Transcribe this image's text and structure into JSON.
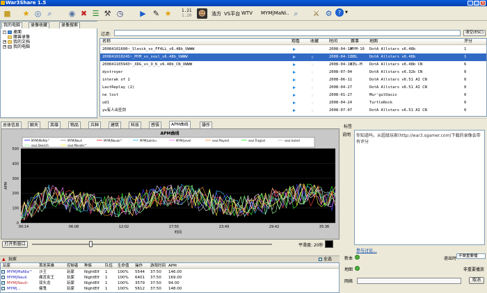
{
  "window": {
    "title": "War3Share 1.5",
    "accent": "#0a5bd8"
  },
  "toolbar": {
    "version_a": "1.21",
    "version_b": "1.20",
    "filter_1": "浩方",
    "filter_2": "VS平台",
    "filter_3": "WTV",
    "player_filter": "MYM|MaNi..",
    "icons": [
      "folder-icon",
      "star-icon",
      "search-icon",
      "settings-icon",
      "stack-icon",
      "clock-icon",
      "play-icon",
      "edit-icon",
      "star-icon",
      "portrait-icon",
      "gear-icon",
      "help-icon"
    ]
  },
  "left": {
    "tabs": [
      "我的电脑",
      "录像收藏",
      "录像搜索"
    ],
    "tree": [
      "桌面",
      "魔兽录像",
      "我的文档",
      "我的电脑"
    ]
  },
  "filter": {
    "label": "过滤:",
    "clear_label": "清空(ESC)"
  },
  "replays": {
    "columns": [
      "名称",
      "观看",
      "收藏",
      "时间",
      "赛事",
      "地图",
      "评分"
    ],
    "rows": [
      {
        "name": "20084101600~_Slevik_vs_FF4LL_v6.48b_UWWW",
        "time": "2008-04-10",
        "event": "MYM-10",
        "map": "DotA Allstars v6.48b",
        "rating": "1",
        "selected": false
      },
      {
        "name": "20084101024S~_MYM_vs_soul_v6.48b_UWWW",
        "time": "2008-04-11",
        "event": "OBL",
        "map": "DotA Allstars v6.48b",
        "rating": "1",
        "selected": true
      },
      {
        "name": "200841105943~_XDG_vs_O_K_v6.48b_CN_UWWW",
        "time": "2008-04-10",
        "event": "CEL-M",
        "map": "DotA Allstars v6.48b CN",
        "rating": "6",
        "selected": false
      },
      {
        "name": "dystroyer",
        "time": "2008-07-04",
        "event": "",
        "map": "DotA Allstars v6.32b CN",
        "rating": "0",
        "selected": false
      },
      {
        "name": "interak of 1",
        "time": "2008-06-11",
        "event": "",
        "map": "DotA Allstars v6.51 AI CN",
        "rating": "0",
        "selected": false
      },
      {
        "name": "LastReplay (2)",
        "time": "2008-04-27",
        "event": "",
        "map": "DotA Allstars v6.51 AI CN",
        "rating": "0",
        "selected": false
      },
      {
        "name": "ne lost",
        "time": "2008-01-27",
        "event": "",
        "map": "Mur'gulOasis",
        "rating": "0",
        "selected": false
      },
      {
        "name": "ud1",
        "time": "2008-04-24",
        "event": "",
        "map": "TurtleRock",
        "rating": "0",
        "selected": false
      },
      {
        "name": "yu有人出圣剑",
        "time": "2008-07-07",
        "event": "",
        "map": "DotA Allstars v6.51 AI CN",
        "rating": "0",
        "selected": false
      }
    ]
  },
  "detail_tabs": [
    "总体信息",
    "聊天",
    "英雄",
    "物品",
    "兵种",
    "建筑",
    "科技",
    "感悟",
    "APM曲线",
    "操作"
  ],
  "active_detail_tab": "APM曲线",
  "chart_data": {
    "type": "line",
    "title": "APM曲线",
    "xlabel": "时间",
    "ylabel": "APM",
    "ylim": [
      0,
      500
    ],
    "yticks": [
      0,
      100,
      200,
      300,
      400,
      500
    ],
    "xticks": [
      "00:14",
      "06:08",
      "12:02",
      "17:55",
      "23:49",
      "29:42",
      "35:36"
    ],
    "series": [
      {
        "name": "MYM|MaNia^",
        "color": "#4040ff"
      },
      {
        "name": "MYM|Nauli",
        "color": "#ffffff"
      },
      {
        "name": "MYM|Nauuk^",
        "color": "#ff4040"
      },
      {
        "name": "MYM|Lakinu",
        "color": "#40c0ff"
      },
      {
        "name": "MYM|Level",
        "color": "#ff80ff"
      },
      {
        "name": "soul.Playeat",
        "color": "#ffa040"
      },
      {
        "name": "soul.TragLot",
        "color": "#40ff40"
      },
      {
        "name": "soul.Isuted",
        "color": "#c0c0c0"
      },
      {
        "name": "soul.Dearich",
        "color": "#a0ffa0"
      },
      {
        "name": "soul.Movalis^",
        "color": "#ffff40"
      }
    ]
  },
  "graph_controls": {
    "open_window": "打开新窗口",
    "smooth_label": "平滑度: 20秒"
  },
  "players": {
    "header": "玩家",
    "select_all": "全选",
    "columns": [
      "玩家",
      "首发英雄",
      "控制者",
      "种族",
      "队伍",
      "生命值",
      "操作",
      "游戏时间",
      "APM"
    ],
    "rows": [
      {
        "name": "MYM|MaNia^",
        "hero": "沙王",
        "ctrl": "玩家",
        "race": "NightElf",
        "team": "1",
        "hp": "100%",
        "ops": "5544",
        "time": "37:50",
        "apm": "146.00",
        "color": "#2020c0"
      },
      {
        "name": "MYM|Nauli",
        "hero": "痛苦女王",
        "ctrl": "玩家",
        "race": "NightElf",
        "team": "1",
        "hp": "100%",
        "ops": "6401",
        "time": "37:50",
        "apm": "169.00",
        "color": "#2020c0"
      },
      {
        "name": "MYM|Nauli-",
        "hero": "双头龙",
        "ctrl": "玩家",
        "race": "NightElf",
        "team": "1",
        "hp": "100%",
        "ops": "3579",
        "time": "37:50",
        "apm": "94.00",
        "color": "#c02020"
      },
      {
        "name": "MYM|...",
        "hero": "瘦鬼",
        "ctrl": "玩家",
        "race": "NightElf",
        "team": "1",
        "hp": "100%",
        "ops": "5612",
        "time": "37:50",
        "apm": "148.00",
        "color": "#2020c0"
      }
    ]
  },
  "right": {
    "tag_label": "标签",
    "desc_label": "说明",
    "desc_text": "你知道吗，从超级玩家(http://war3.sgamer.com)下载的录像会带有评分",
    "discuss_link": "参与讨论...",
    "new_label": "新本",
    "quit_label": "退出时",
    "quit_option": "不做重要播",
    "map_label": "地图",
    "important_label": "非重要播放",
    "network_label": "网络",
    "network_btn": "取消"
  }
}
